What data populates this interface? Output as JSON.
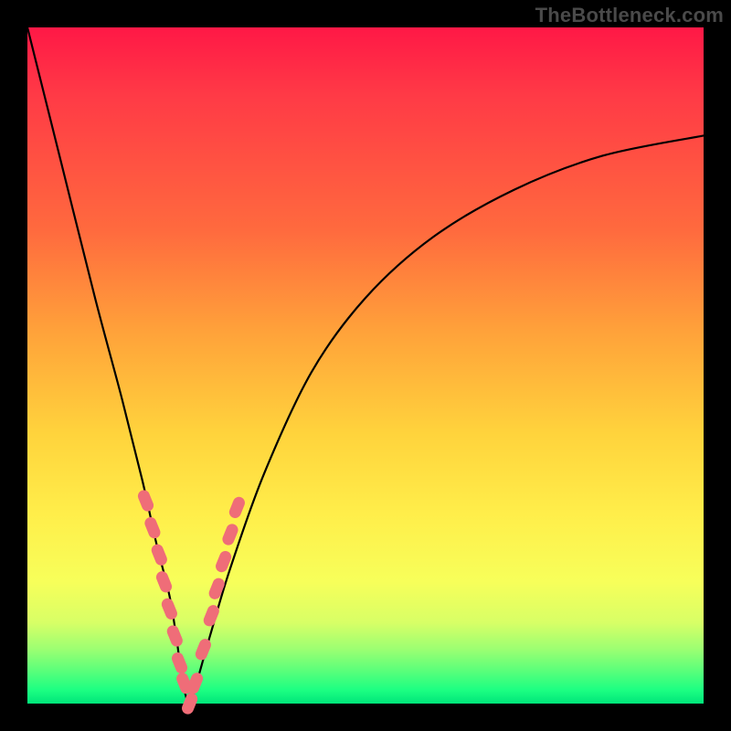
{
  "watermark": "TheBottleneck.com",
  "chart_data": {
    "type": "line",
    "title": "",
    "xlabel": "",
    "ylabel": "",
    "xlim": [
      0,
      100
    ],
    "ylim": [
      0,
      100
    ],
    "legend": false,
    "grid": false,
    "background_gradient": {
      "direction": "vertical",
      "stops": [
        {
          "pos": 0,
          "color": "#ff1846"
        },
        {
          "pos": 0.6,
          "color": "#ffd33c"
        },
        {
          "pos": 0.85,
          "color": "#f7ff5a"
        },
        {
          "pos": 1.0,
          "color": "#00e57a"
        }
      ]
    },
    "series": [
      {
        "name": "bottleneck-curve",
        "x": [
          0,
          5,
          10,
          14,
          17,
          19,
          21,
          22,
          23,
          24,
          25,
          27,
          30,
          35,
          42,
          50,
          60,
          72,
          85,
          100
        ],
        "values": [
          100,
          80,
          60,
          45,
          33,
          24,
          16,
          10,
          3,
          0,
          3,
          10,
          20,
          34,
          49,
          60,
          69,
          76,
          81,
          84
        ]
      }
    ],
    "markers": {
      "name": "highlighted-points",
      "color": "#ef6d78",
      "x": [
        17.5,
        18.5,
        19.5,
        20.2,
        21.0,
        21.8,
        22.5,
        23.2,
        24.0,
        24.8,
        26.0,
        27.2,
        28.0,
        29.0,
        30.0,
        31.0
      ],
      "values": [
        30,
        26,
        22,
        18,
        14,
        10,
        6,
        3,
        0,
        3,
        8,
        13,
        17,
        21,
        25,
        29
      ]
    }
  }
}
